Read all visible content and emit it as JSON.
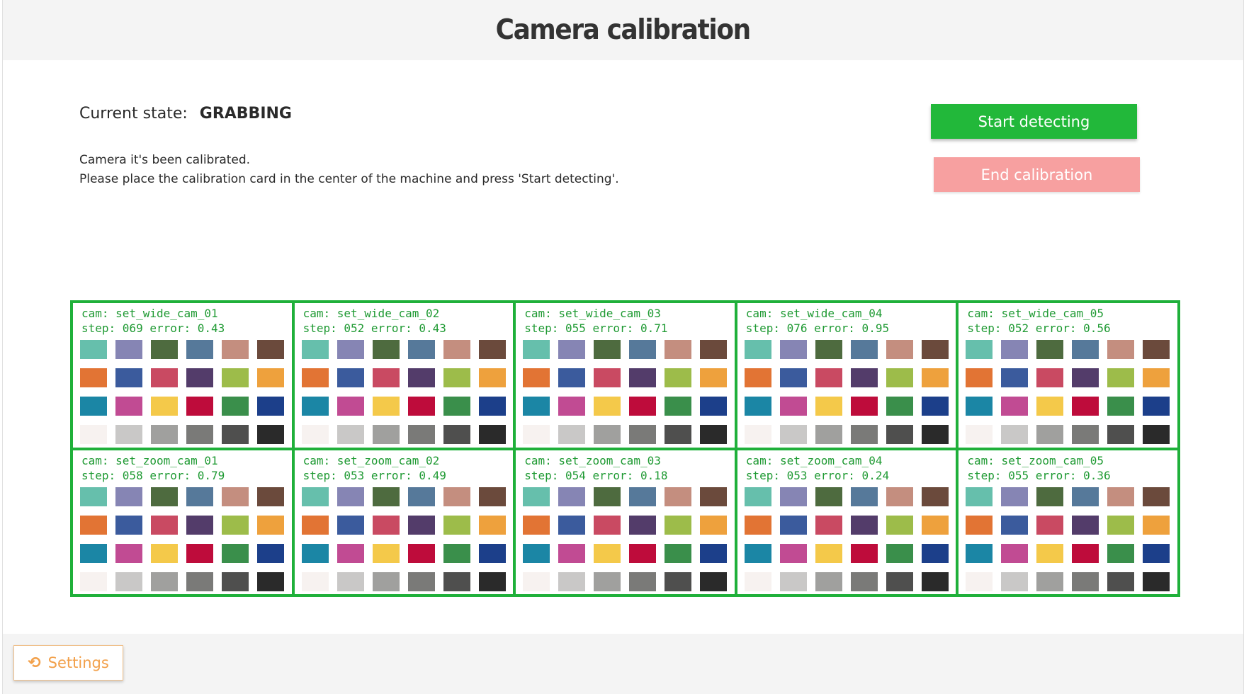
{
  "header": {
    "title": "Camera calibration"
  },
  "status": {
    "label": "Current state:",
    "value": "GRABBING",
    "message_line1": "Camera it's been calibrated.",
    "message_line2": "Please place the calibration card in the center of the machine and press 'Start detecting'."
  },
  "actions": {
    "start_label": "Start detecting",
    "end_label": "End calibration"
  },
  "swatch_colors": [
    "#66bfac",
    "#8685b4",
    "#4e6b3f",
    "#56799a",
    "#c48e7f",
    "#6b4a3c",
    "#e27434",
    "#3b5b9d",
    "#c94a62",
    "#533c6a",
    "#9dbc4a",
    "#eea13d",
    "#1b86a5",
    "#c14b93",
    "#f4c94a",
    "#be0c3b",
    "#3a8f4b",
    "#1c3f8a",
    "#f7f2f0",
    "#c9c8c7",
    "#a0a09e",
    "#7a7a78",
    "#4f4f4e",
    "#2a2a2a"
  ],
  "captures": [
    {
      "cam": "cam: set_wide_cam_01",
      "stats": "step: 069 error: 0.43"
    },
    {
      "cam": "cam: set_wide_cam_02",
      "stats": "step: 052 error: 0.43"
    },
    {
      "cam": "cam: set_wide_cam_03",
      "stats": "step: 055 error: 0.71"
    },
    {
      "cam": "cam: set_wide_cam_04",
      "stats": "step: 076 error: 0.95"
    },
    {
      "cam": "cam: set_wide_cam_05",
      "stats": "step: 052 error: 0.56"
    },
    {
      "cam": "cam: set_zoom_cam_01",
      "stats": "step: 058 error: 0.79"
    },
    {
      "cam": "cam: set_zoom_cam_02",
      "stats": "step: 053 error: 0.49"
    },
    {
      "cam": "cam: set_zoom_cam_03",
      "stats": "step: 054 error: 0.18"
    },
    {
      "cam": "cam: set_zoom_cam_04",
      "stats": "step: 053 error: 0.24"
    },
    {
      "cam": "cam: set_zoom_cam_05",
      "stats": "step: 055 error: 0.36"
    }
  ],
  "footer": {
    "settings_label": "Settings",
    "settings_icon": "undo-icon"
  }
}
